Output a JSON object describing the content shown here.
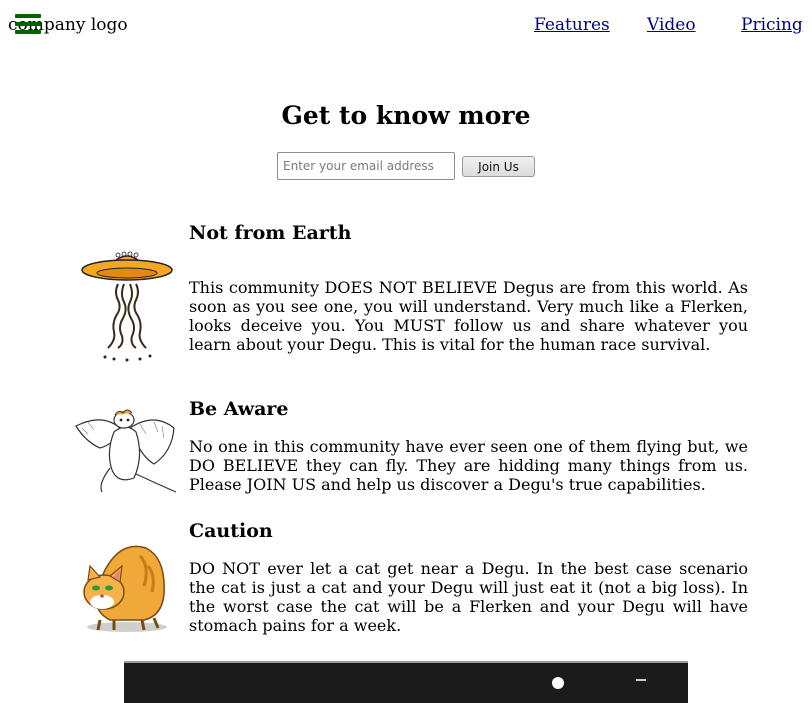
{
  "header": {
    "logo_text": "company logo",
    "nav": [
      {
        "label": "Features"
      },
      {
        "label": "Video"
      },
      {
        "label": "Pricing"
      }
    ],
    "title": "Get to know more",
    "email_placeholder": "Enter your email address",
    "join_label": "Join Us"
  },
  "features": [
    {
      "icon": "ufo-icon",
      "title": "Not from Earth",
      "text": "This community DOES NOT BELIEVE Degus are from this world. As soon as you see one, you will understand. Very much like a Flerken, looks deceive you. You MUST follow us and share whatever you learn about your Degu. This is vital for the human race survival."
    },
    {
      "icon": "flying-degu-icon",
      "title": "Be Aware",
      "text": "No one in this community have ever seen one of them flying but, we DO BELIEVE they can fly. They are hidding many things from us. Please JOIN US and help us discover a Degu's true capabilities."
    },
    {
      "icon": "cat-icon",
      "title": "Caution",
      "text": "DO NOT ever let a cat get near a Degu. In the best case scenario the cat is just a cat and your Degu will just eat it (not a big loss). In the worst case the cat will be a Flerken and your Degu will have stomach pains for a week."
    }
  ],
  "colors": {
    "hamburger": "#006400",
    "nav_link": "#00008b",
    "ufo": "#f5a623",
    "cat": "#f0a838"
  }
}
